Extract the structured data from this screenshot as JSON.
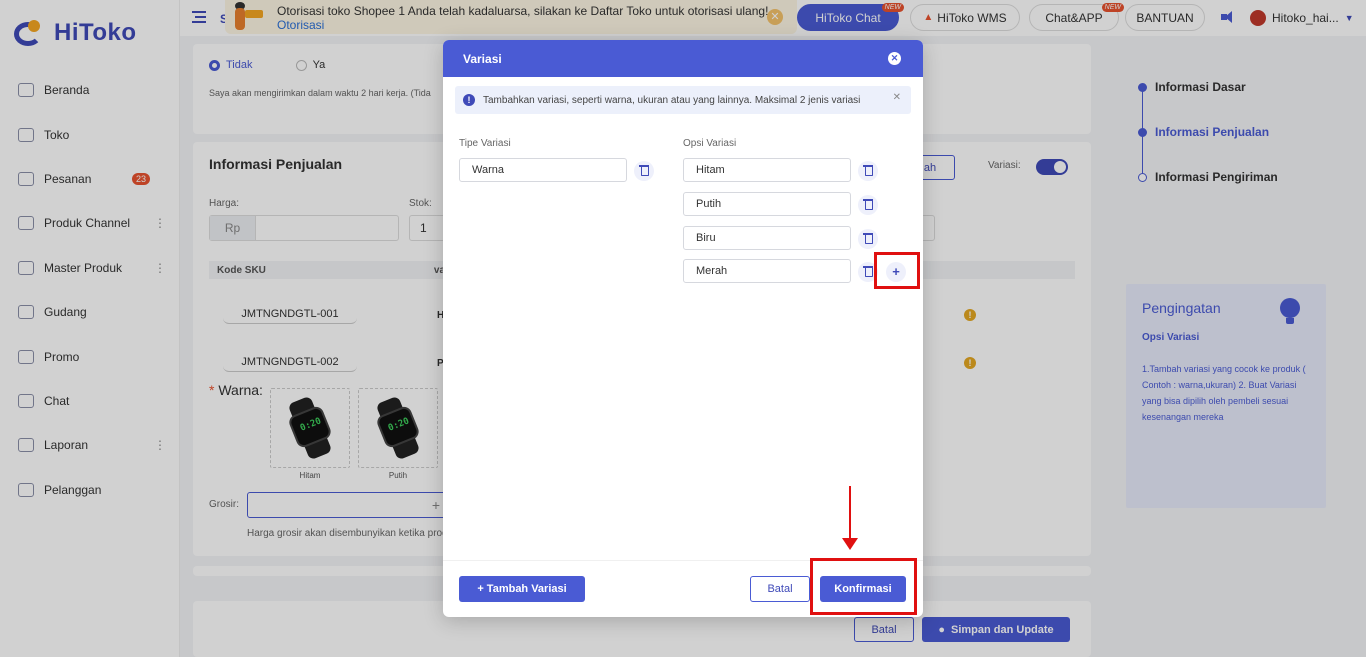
{
  "app": {
    "logo_text": "HiToko"
  },
  "sidebar": {
    "items": [
      {
        "label": "Beranda",
        "icon": "monitor-icon"
      },
      {
        "label": "Toko",
        "icon": "store-icon"
      },
      {
        "label": "Pesanan",
        "icon": "orders-icon",
        "badge": "23"
      },
      {
        "label": "Produk Channel",
        "icon": "grid-icon",
        "more": "⋮"
      },
      {
        "label": "Master Produk",
        "icon": "box-icon",
        "more": "⋮"
      },
      {
        "label": "Gudang",
        "icon": "warehouse-icon"
      },
      {
        "label": "Promo",
        "icon": "promo-icon"
      },
      {
        "label": "Chat",
        "icon": "chat-icon"
      },
      {
        "label": "Laporan",
        "icon": "report-icon",
        "more": "⋮"
      },
      {
        "label": "Pelanggan",
        "icon": "customers-icon"
      }
    ]
  },
  "topbar": {
    "menu_label": "S",
    "notice": {
      "text": "Otorisasi toko Shopee 1 Anda telah kadaluarsa, silakan ke Daftar Toko untuk otorisasi ulang!",
      "link": "Otorisasi",
      "close_symbol": "✕"
    },
    "buttons": {
      "hitoko_chat": "HiToko Chat",
      "hitoko_wms": "HiToko WMS",
      "chat_app": "Chat&APP",
      "bantuan": "BANTUAN",
      "new_badge": "NEW"
    },
    "user": "Hitoko_hai...",
    "caret": "▼"
  },
  "background": {
    "radio_no": "Tidak",
    "radio_yes": "Ya",
    "ship_note": "Saya akan mengirimkan dalam waktu 2 hari kerja. (Tida",
    "sales_title": "Informasi Penjualan",
    "add_button_partial": "ah",
    "variation_label": "Variasi:",
    "price_label": "Harga:",
    "price_prefix": "Rp",
    "stock_label": "Stok:",
    "stock_value": "1",
    "table_head_sku": "Kode SKU",
    "table_head_var": "va",
    "sku_rows": [
      {
        "code": "JMTNGNDGTL-001",
        "var": "H"
      },
      {
        "code": "JMTNGNDGTL-002",
        "var": "P"
      }
    ],
    "warn_symbol": "!",
    "required_mark": "*",
    "color_label": "Warna:",
    "watch_digits": "0:20",
    "thumbs": [
      "Hitam",
      "Putih"
    ],
    "grosir_label": "Grosir:",
    "grosir_plus": "+",
    "grosir_note": "Harga grosir akan disembunyikan ketika produ",
    "cancel": "Batal",
    "save_update": "Simpan dan Update"
  },
  "steps": [
    {
      "label": "Informasi Dasar",
      "state": "done"
    },
    {
      "label": "Informasi Penjualan",
      "state": "active"
    },
    {
      "label": "Informasi Pengiriman",
      "state": "todo"
    }
  ],
  "reminder": {
    "title": "Pengingatan",
    "subtitle": "Opsi Variasi",
    "body": "1.Tambah variasi yang cocok ke produk ( Contoh : warna,ukuran) 2. Buat Variasi yang bisa dipilih oleh pembeli sesuai kesenangan mereka"
  },
  "modal": {
    "title": "Variasi",
    "close_symbol": "✕",
    "info": "Tambahkan variasi, seperti warna, ukuran atau yang lainnya. Maksimal 2 jenis variasi",
    "info_icon": "!",
    "info_close": "✕",
    "type_label": "Tipe Variasi",
    "type_value": "Warna",
    "options_label": "Opsi Variasi",
    "options": [
      "Hitam",
      "Putih",
      "Biru",
      "Merah"
    ],
    "add_option_symbol": "+",
    "add_variation": "+ Tambah Variasi",
    "cancel": "Batal",
    "confirm": "Konfirmasi"
  },
  "colors": {
    "primary": "#4a5bd4",
    "annotation_red": "#e01010",
    "badge_red": "#e8522f",
    "warning": "#e5a823"
  }
}
